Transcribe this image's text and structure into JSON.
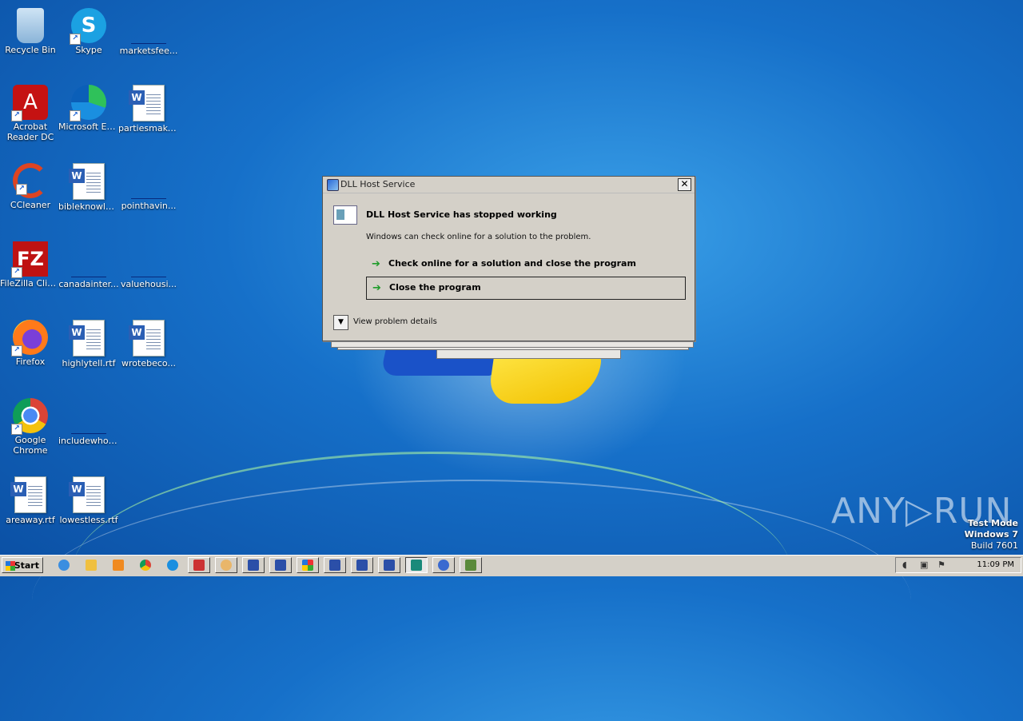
{
  "desktop": {
    "icons": [
      {
        "label": "Recycle Bin",
        "icon": "recycle-bin-icon"
      },
      {
        "label": "Skype",
        "icon": "skype-icon"
      },
      {
        "label": "marketsfee...",
        "icon": "blank-file-icon"
      },
      {
        "label": "Acrobat Reader DC",
        "icon": "acrobat-icon"
      },
      {
        "label": "Microsoft Edge",
        "icon": "edge-icon"
      },
      {
        "label": "partiesmake...",
        "icon": "word-doc-icon"
      },
      {
        "label": "CCleaner",
        "icon": "ccleaner-icon"
      },
      {
        "label": "bibleknowle...",
        "icon": "word-doc-icon"
      },
      {
        "label": "pointhavin...",
        "icon": "blank-file-icon"
      },
      {
        "label": "FileZilla Client",
        "icon": "filezilla-icon"
      },
      {
        "label": "canadainter...",
        "icon": "blank-file-icon"
      },
      {
        "label": "valuehousi...",
        "icon": "blank-file-icon"
      },
      {
        "label": "Firefox",
        "icon": "firefox-icon"
      },
      {
        "label": "highlytell.rtf",
        "icon": "word-doc-icon"
      },
      {
        "label": "wrotebeco...",
        "icon": "word-doc-icon"
      },
      {
        "label": "Google Chrome",
        "icon": "chrome-icon"
      },
      {
        "label": "includewhol...",
        "icon": "blank-file-icon"
      },
      {
        "label": "areaway.rtf",
        "icon": "word-doc-icon"
      },
      {
        "label": "lowestless.rtf",
        "icon": "word-doc-icon"
      }
    ]
  },
  "dialog": {
    "title": "DLL Host Service",
    "close_glyph": "✕",
    "heading": "DLL Host Service has stopped working",
    "subtext": "Windows can check online for a solution to the problem.",
    "option_check_online": "Check online for a solution and close the program",
    "option_close": "Close the program",
    "details_label": "View problem details",
    "arrow_glyph": "➔",
    "expand_glyph": "▼"
  },
  "watermark": {
    "brand": "ANY▷RUN",
    "test_mode": "Test Mode",
    "os": "Windows 7",
    "build": "Build 7601"
  },
  "taskbar": {
    "start_label": "Start",
    "clock": "11:09 PM",
    "colors": {
      "accent": "#2b6ad8",
      "green": "#1f9c2a"
    }
  }
}
